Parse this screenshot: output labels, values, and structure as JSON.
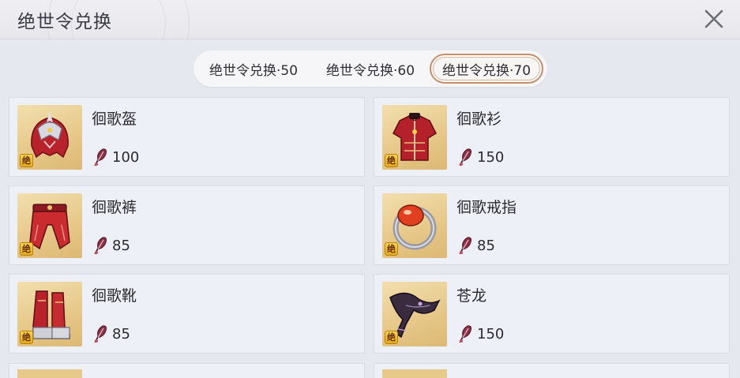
{
  "window": {
    "title": "绝世令兑换",
    "close_icon": "close-icon"
  },
  "tabs": [
    {
      "label": "绝世令兑换·50",
      "active": false
    },
    {
      "label": "绝世令兑换·60",
      "active": false
    },
    {
      "label": "绝世令兑换·70",
      "active": true
    }
  ],
  "items": [
    {
      "name": "徊歌盔",
      "cost": "100",
      "icon": "red-helmet-icon",
      "grade": "绝"
    },
    {
      "name": "徊歌衫",
      "cost": "150",
      "icon": "red-armor-icon",
      "grade": "绝"
    },
    {
      "name": "徊歌裤",
      "cost": "85",
      "icon": "red-pants-icon",
      "grade": "绝"
    },
    {
      "name": "徊歌戒指",
      "cost": "85",
      "icon": "gem-ring-icon",
      "grade": "绝"
    },
    {
      "name": "徊歌靴",
      "cost": "85",
      "icon": "red-boots-icon",
      "grade": "绝"
    },
    {
      "name": "苍龙",
      "cost": "150",
      "icon": "dark-dragon-weapon-icon",
      "grade": "绝"
    }
  ],
  "currency_icon": "token-feather-icon",
  "colors": {
    "accent_border": "#c58f6e",
    "icon_bg": "#e7c98a",
    "grade_badge": "#f7d54a"
  }
}
